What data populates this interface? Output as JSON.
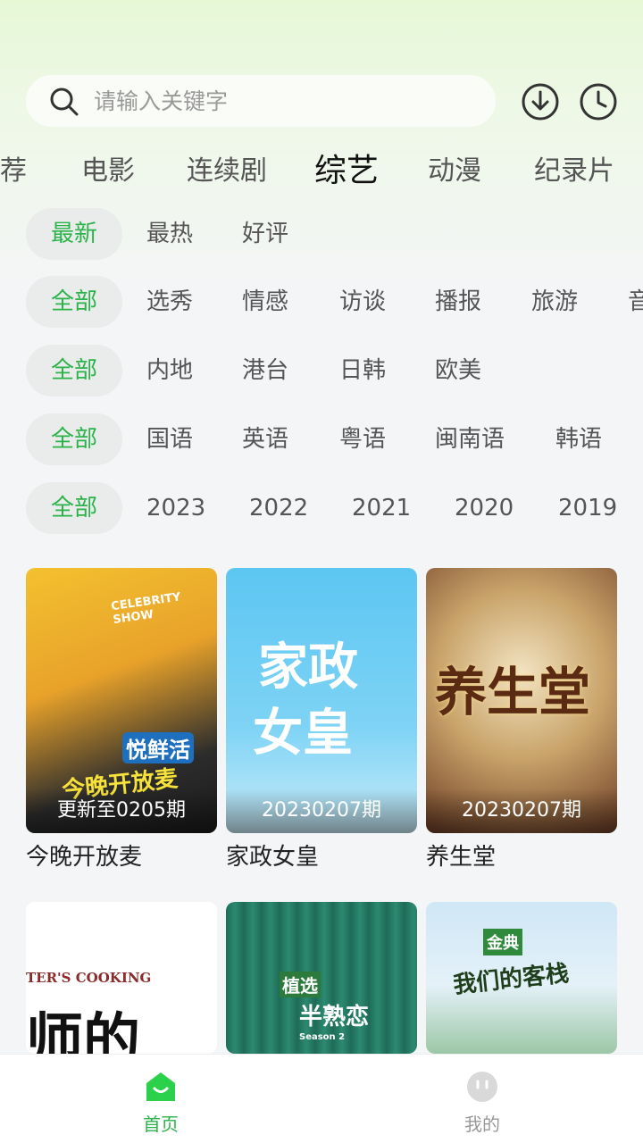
{
  "search": {
    "placeholder": "请输入关键字"
  },
  "header_icons": {
    "download": "download-icon",
    "history": "clock-icon"
  },
  "tabs": [
    {
      "label": "荐"
    },
    {
      "label": "电影"
    },
    {
      "label": "连续剧"
    },
    {
      "label": "综艺",
      "active": true
    },
    {
      "label": "动漫"
    },
    {
      "label": "纪录片"
    }
  ],
  "filters": {
    "sort": [
      "最新",
      "最热",
      "好评"
    ],
    "type": [
      "全部",
      "选秀",
      "情感",
      "访谈",
      "播报",
      "旅游",
      "音"
    ],
    "region": [
      "全部",
      "内地",
      "港台",
      "日韩",
      "欧美"
    ],
    "language": [
      "全部",
      "国语",
      "英语",
      "粤语",
      "闽南语",
      "韩语"
    ],
    "year": [
      "全部",
      "2023",
      "2022",
      "2021",
      "2020",
      "2019"
    ]
  },
  "cards": [
    {
      "title": "今晚开放麦",
      "episode": "更新至0205期",
      "poster_texts": [
        "CELEBRITY SHOW",
        "悦鲜活",
        "今晚开放麦"
      ]
    },
    {
      "title": "家政女皇",
      "episode": "20230207期",
      "poster_texts": [
        "家政",
        "女皇"
      ]
    },
    {
      "title": "养生堂",
      "episode": "20230207期",
      "poster_texts": [
        "养生堂"
      ]
    },
    {
      "title": "",
      "episode": "",
      "poster_texts": [
        "TER'S COOKING",
        "师的"
      ]
    },
    {
      "title": "",
      "episode": "",
      "poster_texts": [
        "植选",
        "半熟恋",
        "Season 2"
      ]
    },
    {
      "title": "",
      "episode": "",
      "poster_texts": [
        "金典",
        "我们的客栈"
      ]
    }
  ],
  "bottom_nav": [
    {
      "label": "首页",
      "icon": "home-icon",
      "active": true
    },
    {
      "label": "我的",
      "icon": "user-face-icon",
      "active": false
    }
  ],
  "colors": {
    "accent": "#2bb34a",
    "background": "#f4f5f7",
    "header_tint": "#e6f8d6"
  }
}
